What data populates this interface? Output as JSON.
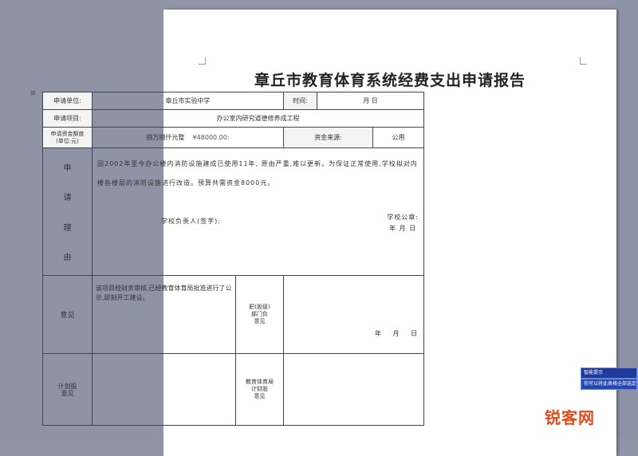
{
  "document": {
    "title": "章丘市教育体育系统经费支出申请报告",
    "table": {
      "r1": {
        "apply_unit_label": "申请单位:",
        "apply_unit_value": "章丘市实验中学",
        "time_label": "时间:",
        "time_value": "月 日"
      },
      "r2": {
        "project_label": "申请项目:",
        "project_value": "办公室内研究道德修养成工程"
      },
      "r3": {
        "amount_label": "申请资金额度",
        "amount_sub": "(单位:元)",
        "amount_value": "捌万捌仟元整",
        "amount_number": "¥48000.00:",
        "fund_source_label": "资金来源:",
        "fund_source_value": "公用"
      },
      "reason": {
        "label_chars": [
          "申",
          "请",
          "理",
          "由"
        ],
        "text": "因2002年至今办公楼内消防设施建成已使用11年, 原由严重,难以更新。为保证正常使用,学校拟对内楼各楼层的消防设施进行改造。预算共需资金8000元。",
        "signer_label": "学校负责人(签字):",
        "seal_label": "学校公章:",
        "date_label": "年 月 日"
      },
      "opinion": {
        "label": "意见",
        "text": "该项目经财务审核,已经教育体育局批准进行了公示,即刻开工建设。",
        "dept_label": "职(股级)\n部门负\n意见",
        "date_label": "年 月 日"
      },
      "plan": {
        "label": "计划股\n意见",
        "finance_label": "教育体育局\n计财股\n意见"
      }
    },
    "popup": {
      "line1": "智能提示",
      "line2": "你可以将此表格全部选定"
    },
    "watermark": "锐客网"
  }
}
